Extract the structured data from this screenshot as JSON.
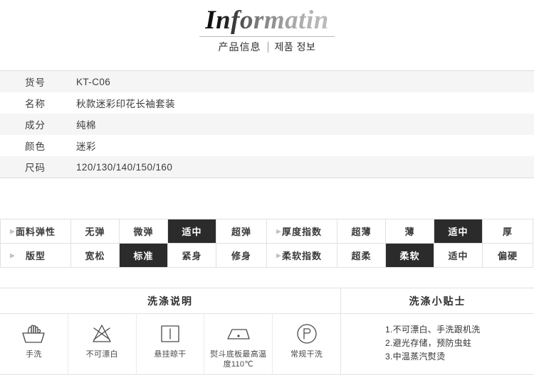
{
  "header": {
    "brand_title": "Informatin",
    "subtitle_cn": "产品信息",
    "subtitle_kr": "제품 정보"
  },
  "spec_table": {
    "rows": [
      {
        "label": "货号",
        "value": "KT-C06"
      },
      {
        "label": "名称",
        "value": "秋款迷彩印花长袖套装"
      },
      {
        "label": "成分",
        "value": "纯棉"
      },
      {
        "label": "颜色",
        "value": "迷彩"
      },
      {
        "label": "尺码",
        "value": "120/130/140/150/160"
      }
    ]
  },
  "attributes": {
    "caret_glyph": "▶",
    "rows": [
      {
        "left": {
          "label": "面料弹性",
          "options": [
            {
              "text": "无弹",
              "selected": false
            },
            {
              "text": "微弹",
              "selected": false
            },
            {
              "text": "适中",
              "selected": true
            },
            {
              "text": "超弹",
              "selected": false
            }
          ]
        },
        "right": {
          "label": "厚度指数",
          "options": [
            {
              "text": "超薄",
              "selected": false
            },
            {
              "text": "薄",
              "selected": false
            },
            {
              "text": "适中",
              "selected": true
            },
            {
              "text": "厚",
              "selected": false
            }
          ]
        }
      },
      {
        "left": {
          "label": "版型",
          "options": [
            {
              "text": "宽松",
              "selected": false
            },
            {
              "text": "标准",
              "selected": true
            },
            {
              "text": "紧身",
              "selected": false
            },
            {
              "text": "修身",
              "selected": false
            }
          ]
        },
        "right": {
          "label": "柔软指数",
          "options": [
            {
              "text": "超柔",
              "selected": false
            },
            {
              "text": "柔软",
              "selected": true
            },
            {
              "text": "适中",
              "selected": false
            },
            {
              "text": "偏硬",
              "selected": false
            }
          ]
        }
      }
    ]
  },
  "wash": {
    "title": "洗涤说明",
    "items": [
      {
        "icon": "hand-wash-icon",
        "caption": "手洗"
      },
      {
        "icon": "do-not-bleach-icon",
        "caption": "不可漂白"
      },
      {
        "icon": "line-dry-icon",
        "caption": "悬挂晾干"
      },
      {
        "icon": "iron-low-temp-icon",
        "caption": "熨斗底板最高温度110℃"
      },
      {
        "icon": "dry-clean-icon",
        "caption": "常规干洗"
      }
    ]
  },
  "tips": {
    "title": "洗涤小贴士",
    "lines": [
      "1.不可漂白、手洗跟机洗",
      "2.避光存储，预防虫蛀",
      "3.中温蒸汽熨烫"
    ]
  }
}
